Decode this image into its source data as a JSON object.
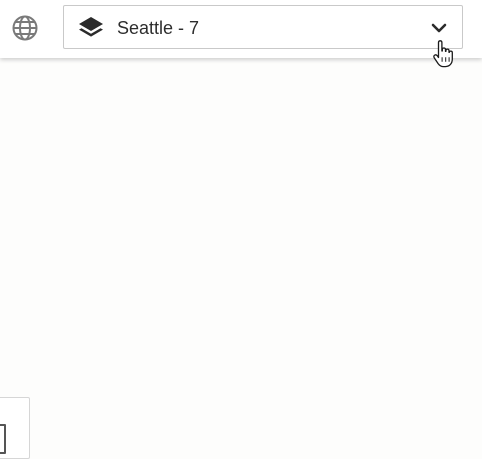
{
  "toolbar": {
    "globe_icon": "globe-icon",
    "layer_selector": {
      "icon": "layers-icon",
      "selected_value": "Seattle - 7",
      "chevron_icon": "chevron-down-icon"
    }
  },
  "colors": {
    "icon": "#2b2b2b",
    "globe": "#7a7a7a",
    "border": "#c9c9c9",
    "background": "#fdfdfc"
  }
}
